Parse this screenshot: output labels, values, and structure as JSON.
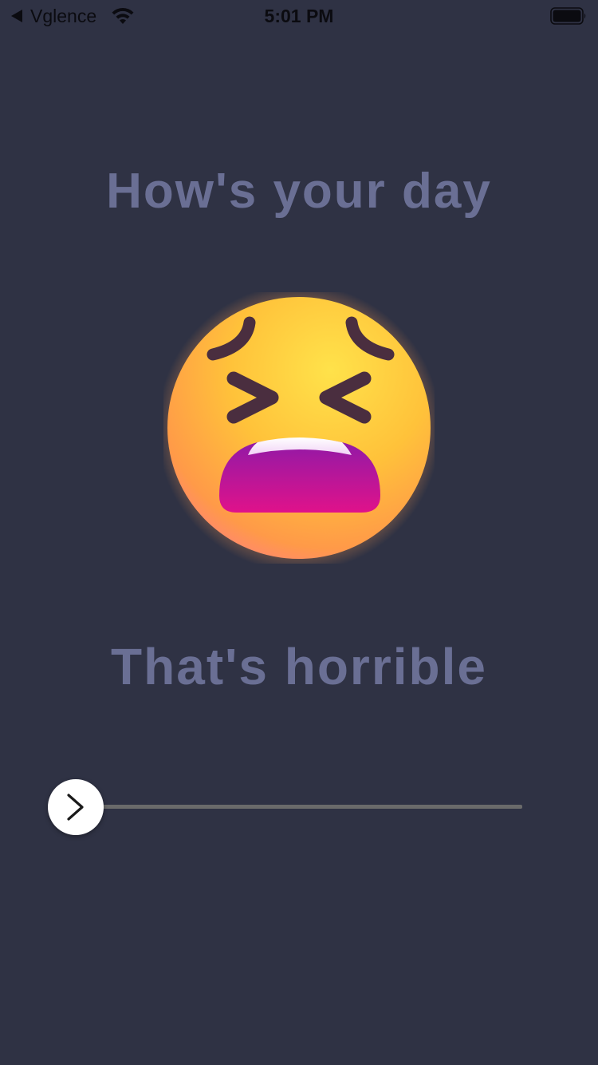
{
  "status_bar": {
    "back_app": "Vglence",
    "time": "5:01 PM",
    "icons": [
      "back-caret-icon",
      "wifi-icon",
      "battery-icon"
    ]
  },
  "prompt": {
    "title": "How's your day"
  },
  "mood": {
    "emoji": "tired-face-emoji",
    "label": "That's horrible"
  },
  "slider": {
    "value_fraction": 0.0,
    "thumb_icon": "chevron-right-icon"
  },
  "colors": {
    "background": "#2f3244",
    "text_muted": "#6a6f94",
    "track": "#6a6a6a",
    "thumb": "#ffffff"
  }
}
